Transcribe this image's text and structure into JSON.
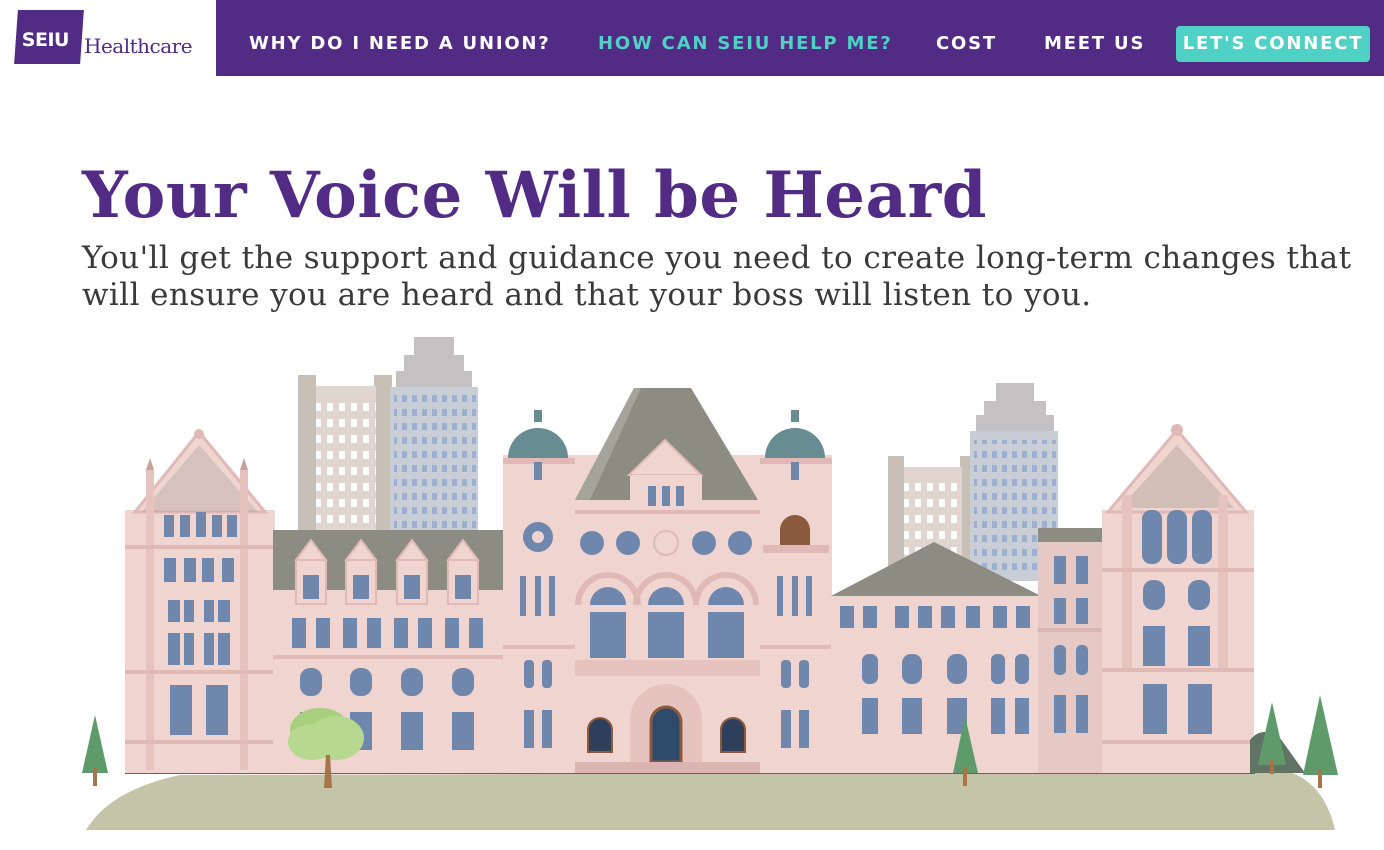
{
  "logo": {
    "mark": "SEIU",
    "word": "Healthcare"
  },
  "nav": {
    "items": [
      {
        "label": "WHY DO I NEED A UNION?"
      },
      {
        "label": "HOW CAN SEIU HELP ME?"
      },
      {
        "label": "COST"
      },
      {
        "label": "MEET US"
      }
    ],
    "cta": "LET'S CONNECT"
  },
  "hero": {
    "title": "Your Voice Will be Heard",
    "subtitle": "You'll get the support and guidance you need to create long-term changes that will ensure you are heard and that your boss will listen to you."
  },
  "colors": {
    "brand_purple": "#512b84",
    "accent_teal": "#4fd1c5",
    "building_pink": "#efd4cf",
    "roof_gray": "#8d8c82",
    "window_blue": "#6f86ad",
    "dome_teal": "#678c91",
    "ground": "#c3c4a8"
  }
}
